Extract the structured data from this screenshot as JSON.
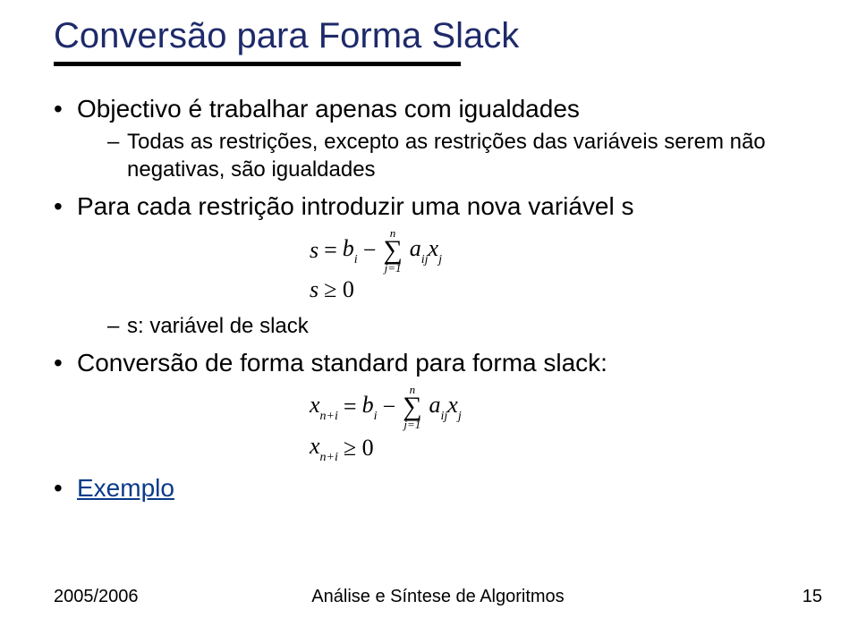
{
  "title": "Conversão para Forma Slack",
  "bullets": {
    "b1": "Objectivo é trabalhar apenas com igualdades",
    "b1_sub1": "Todas as restrições, excepto as restrições das variáveis serem não negativas, são igualdades",
    "b2": "Para cada restrição introduzir uma nova variável s",
    "b2_sub1": "s: variável de slack",
    "b3": "Conversão de forma standard para forma slack:",
    "b4": "Exemplo"
  },
  "eq": {
    "s": "s",
    "eq_sign": "=",
    "b": "b",
    "i": "i",
    "minus": "−",
    "n": "n",
    "j1": "j=1",
    "a": "a",
    "ij": "ij",
    "x": "x",
    "j": "j",
    "ge0": "≥ 0",
    "xn_i": "n+i"
  },
  "footer": {
    "left": "2005/2006",
    "center": "Análise e Síntese de Algoritmos",
    "right": "15"
  }
}
